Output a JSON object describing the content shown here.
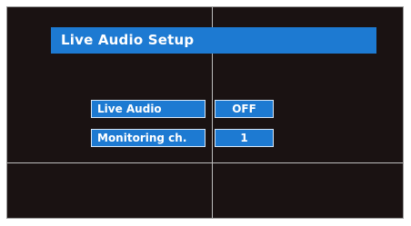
{
  "menu": {
    "title": "Live Audio Setup",
    "items": [
      {
        "label": "Live Audio",
        "value": "OFF"
      },
      {
        "label": "Monitoring ch.",
        "value": "1"
      }
    ]
  },
  "colors": {
    "background": "#1a1212",
    "accent": "#1d7ad2",
    "text": "#ffffff",
    "grid_lines": "#bdbdbd"
  }
}
